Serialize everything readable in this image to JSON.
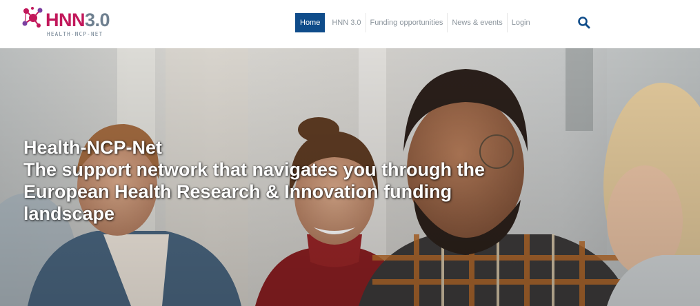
{
  "logo": {
    "brand_prefix": "HNN",
    "brand_version": "3.0",
    "tagline": "HEALTH-NCP-NET"
  },
  "nav": {
    "items": [
      {
        "label": "Home",
        "active": true
      },
      {
        "label": "HNN 3.0",
        "active": false
      },
      {
        "label": "Funding opportunities",
        "active": false
      },
      {
        "label": "News & events",
        "active": false
      },
      {
        "label": "Login",
        "active": false
      }
    ],
    "search_icon": "search-icon"
  },
  "hero": {
    "lines": [
      "Health-NCP-Net",
      "The support network that navigates you through the",
      "European Health Research & Innovation funding",
      "landscape"
    ]
  },
  "colors": {
    "brand_magenta": "#c2185b",
    "brand_gray": "#6f8090",
    "nav_active_bg": "#0f4c8a",
    "nav_text": "#8c959d",
    "search_icon": "#0f4c8a"
  }
}
